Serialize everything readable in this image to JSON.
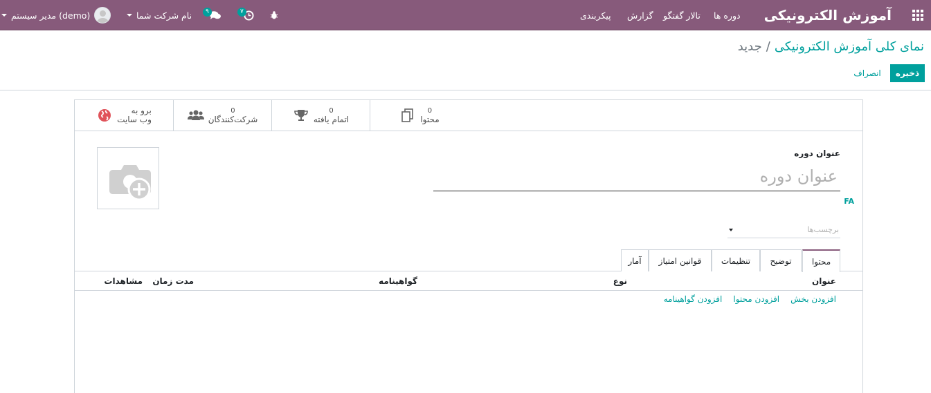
{
  "navbar": {
    "brand": "آموزش الکترونیکی",
    "menu": [
      "دوره ها",
      "تالار گفتگو",
      "گزارش",
      "پیکربندی"
    ],
    "activity_count": "۷",
    "message_count": "۹",
    "company": "نام شرکت شما",
    "user": "مدیر سیستم (demo)"
  },
  "breadcrumb": {
    "parent": "نمای کلی آموزش الکترونیکی",
    "separator": "/",
    "current": "جدید"
  },
  "actions": {
    "save": "ذخیره",
    "discard": "انصراف"
  },
  "stat_buttons": {
    "content": {
      "value": "0",
      "label": "محتوا"
    },
    "completed": {
      "value": "0",
      "label": "اتمام یافته"
    },
    "attendees": {
      "value": "0",
      "label": "شرکت‌کنندگان"
    },
    "website": {
      "line1": "برو به",
      "line2": "وب سایت"
    }
  },
  "form": {
    "title_label": "عنوان دوره",
    "title_placeholder": "عنوان دوره",
    "lang": "FA",
    "tags_placeholder": "برچسب‌ها"
  },
  "tabs": [
    "محتوا",
    "توضیح",
    "تنظیمات",
    "قوانین امتیاز",
    "آمار"
  ],
  "table": {
    "columns": [
      "عنوان",
      "نوع",
      "گواهینامه",
      "مدت زمان",
      "مشاهدات"
    ]
  },
  "add_links": [
    "افزودن بخش",
    "افزودن محتوا",
    "افزودن گواهینامه"
  ],
  "colors": {
    "navbar": "#875a7b",
    "primary": "#00a09d"
  }
}
